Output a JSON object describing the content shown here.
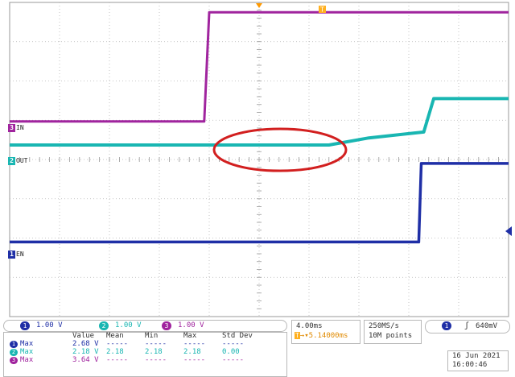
{
  "chart_data": {
    "type": "line",
    "title": "",
    "xlabel": "",
    "ylabel": "",
    "grid": true,
    "timebase": "4.00ms",
    "trigger_position": "5.14000ms",
    "sample_rate": "250MS/s",
    "record_length": "10M points",
    "trigger_level": "640mV",
    "date": "16 Jun 2021",
    "time": "16:00:46",
    "x_divisions": 10,
    "y_divisions": 8,
    "series": [
      {
        "name": "IN",
        "channel": "3",
        "color": "#a0249e",
        "scale": "1.00 V",
        "points_div": [
          [
            0,
            4.97
          ],
          [
            3.9,
            4.97
          ],
          [
            4.0,
            7.75
          ],
          [
            10,
            7.75
          ]
        ]
      },
      {
        "name": "OUT",
        "channel": "2",
        "color": "#19b6b2",
        "scale": "1.00 V",
        "points_div": [
          [
            0,
            4.37
          ],
          [
            6.4,
            4.37
          ],
          [
            7.2,
            4.55
          ],
          [
            8.3,
            4.7
          ],
          [
            8.5,
            5.55
          ],
          [
            10,
            5.55
          ]
        ]
      },
      {
        "name": "EN",
        "channel": "1",
        "color": "#1f2fa6",
        "scale": "1.00 V",
        "points_div": [
          [
            0,
            1.9
          ],
          [
            8.2,
            1.9
          ],
          [
            8.25,
            3.9
          ],
          [
            10,
            3.9
          ]
        ]
      }
    ],
    "annotation": "ellipse highlighting OUT ramp",
    "measurements": {
      "headers": [
        "Value",
        "Mean",
        "Min",
        "Max",
        "Std Dev"
      ],
      "rows": [
        {
          "channel": "1",
          "label": "Max",
          "color": "#1f2fa6",
          "value": "2.68 V",
          "mean": "-----",
          "min": "-----",
          "max": "-----",
          "std": "-----"
        },
        {
          "channel": "2",
          "label": "Max",
          "color": "#19b6b2",
          "value": "2.18 V",
          "mean": "2.18",
          "min": "2.18",
          "max": "2.18",
          "std": "0.00"
        },
        {
          "channel": "3",
          "label": "Max",
          "color": "#a0249e",
          "value": "3.64 V",
          "mean": "-----",
          "min": "-----",
          "max": "-----",
          "std": "-----"
        }
      ]
    }
  },
  "labels": {
    "in": "IN",
    "out": "OUT",
    "en": "EN",
    "ch1": "1",
    "ch2": "2",
    "ch3": "3"
  },
  "status": {
    "ch1_scale": "1.00 V",
    "ch2_scale": "1.00 V",
    "ch3_scale": "1.00 V",
    "timebase": "4.00ms",
    "trigger_pos": "5.14000ms",
    "sample_rate": "250MS/s",
    "record_length": "10M points",
    "trigger_source": "1",
    "trigger_level": "640mV",
    "date": "16 Jun 2021",
    "time": "16:00:46"
  }
}
